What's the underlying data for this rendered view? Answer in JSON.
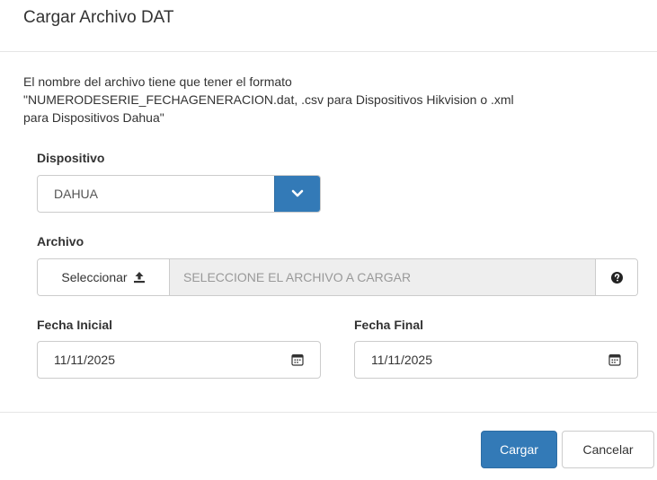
{
  "modal": {
    "title": "Cargar Archivo DAT"
  },
  "description": {
    "line1": "El nombre del archivo tiene que tener el formato",
    "line2": "\"NUMERODESERIE_FECHAGENERACION.dat, .csv para Dispositivos Hikvision o .xml",
    "line3": "para Dispositivos Dahua\""
  },
  "dispositivo": {
    "label": "Dispositivo",
    "selected": "DAHUA",
    "toggle_icon": "chevron-down-icon"
  },
  "archivo": {
    "label": "Archivo",
    "select_label": "Seleccionar",
    "select_icon": "upload-icon",
    "placeholder": "SELECCIONE EL ARCHIVO A CARGAR",
    "help_icon": "question-circle-icon"
  },
  "fecha_inicial": {
    "label": "Fecha Inicial",
    "value": "11/11/2025",
    "icon": "calendar-icon"
  },
  "fecha_final": {
    "label": "Fecha Final",
    "value": "11/11/2025",
    "icon": "calendar-icon"
  },
  "footer": {
    "submit_label": "Cargar",
    "cancel_label": "Cancelar"
  },
  "colors": {
    "primary": "#337ab7",
    "border": "#cccccc",
    "readonly_bg": "#eeeeee"
  }
}
